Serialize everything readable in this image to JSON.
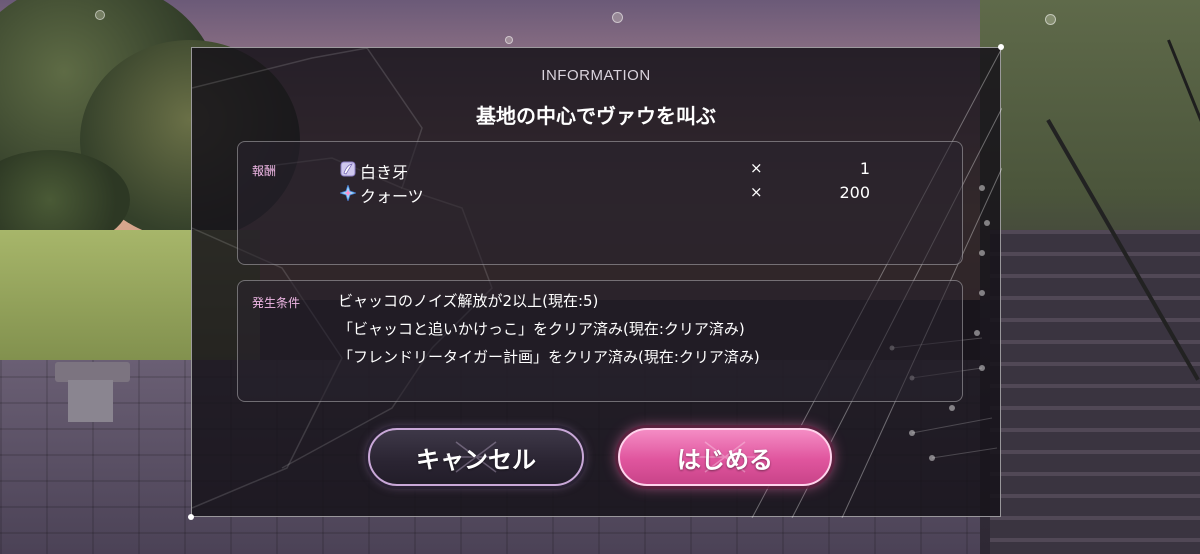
{
  "dialog": {
    "header": "INFORMATION",
    "title": "基地の中心でヴァウを叫ぶ"
  },
  "rewards": {
    "label": "報酬",
    "items": [
      {
        "icon": "white-fang-item-icon",
        "name": "白き牙",
        "times": "×",
        "quantity": "1"
      },
      {
        "icon": "quartz-star-icon",
        "name": "クォーツ",
        "times": "×",
        "quantity": "200"
      }
    ]
  },
  "conditions": {
    "label": "発生条件",
    "lines": [
      "ビャッコのノイズ解放が2以上(現在:5)",
      "「ビャッコと追いかけっこ」をクリア済み(現在:クリア済み)",
      "「フレンドリータイガー計画」をクリア済み(現在:クリア済み)"
    ]
  },
  "buttons": {
    "cancel": "キャンセル",
    "start": "はじめる"
  },
  "colors": {
    "accent_pink": "#e0559e",
    "label_pink": "#f0b8e6",
    "dialog_bg": "#16131a"
  }
}
